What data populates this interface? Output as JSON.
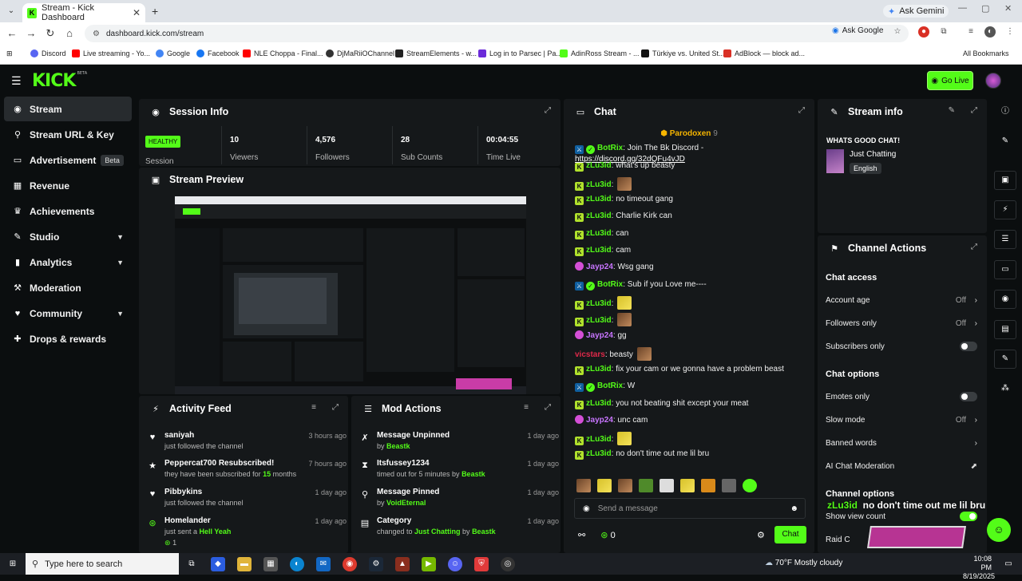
{
  "browser": {
    "tab_title": "Stream - Kick Dashboard",
    "url": "dashboard.kick.com/stream",
    "gemini_label": "Ask Gemini",
    "ask_google": "Ask Google",
    "bookmarks": [
      "Discord",
      "Live streaming - Yo...",
      "Google",
      "Facebook",
      "NLE Choppa - Final...",
      "DjMaRiiOChannel",
      "StreamElements - w...",
      "Log in to Parsec | Pa...",
      "AdinRoss Stream - ...",
      "Türkiye vs. United St...",
      "AdBlock — block ad..."
    ],
    "all_bookmarks": "All Bookmarks"
  },
  "topbar": {
    "logo": "KICK",
    "beta": "BETA",
    "go_live": "Go Live"
  },
  "sidebar": {
    "items": [
      {
        "label": "Stream",
        "icon": "broadcast-icon"
      },
      {
        "label": "Stream URL & Key",
        "icon": "key-icon"
      },
      {
        "label": "Advertisement",
        "icon": "ad-icon",
        "badge": "Beta"
      },
      {
        "label": "Revenue",
        "icon": "revenue-icon"
      },
      {
        "label": "Achievements",
        "icon": "trophy-icon"
      },
      {
        "label": "Studio",
        "icon": "studio-icon"
      },
      {
        "label": "Analytics",
        "icon": "analytics-icon"
      },
      {
        "label": "Moderation",
        "icon": "moderation-icon"
      },
      {
        "label": "Community",
        "icon": "community-icon"
      },
      {
        "label": "Drops & rewards",
        "icon": "gift-icon"
      }
    ]
  },
  "session": {
    "title": "Session Info",
    "health": "HEALTHY",
    "session_label": "Session",
    "viewers": "10",
    "viewers_label": "Viewers",
    "followers": "4,576",
    "followers_label": "Followers",
    "subs": "28",
    "subs_label": "Sub Counts",
    "time": "00:04:55",
    "time_label": "Time Live"
  },
  "preview": {
    "title": "Stream Preview"
  },
  "activity": {
    "title": "Activity Feed",
    "items": [
      {
        "name": "saniyah",
        "sub": "just followed the channel",
        "time": "3 hours ago"
      },
      {
        "name": "Peppercat700 Resubscribed!",
        "sub_pre": "they have been subscribed for ",
        "sub_num": "15",
        "sub_post": " months",
        "time": "7 hours ago"
      },
      {
        "name": "Pibbykins",
        "sub": "just followed the channel",
        "time": "1 day ago"
      },
      {
        "name": "Homelander",
        "sub_pre": "just sent a ",
        "sub_hl": "Hell Yeah",
        "count": "1",
        "time": "1 day ago"
      }
    ]
  },
  "mod": {
    "title": "Mod Actions",
    "items": [
      {
        "name": "Message Unpinned",
        "by": "by ",
        "who": "Beastk",
        "time": "1 day ago"
      },
      {
        "name": "Itsfussey1234",
        "pre": "timed out for 5 minutes by ",
        "who": "Beastk",
        "time": "1 day ago"
      },
      {
        "name": "Message Pinned",
        "by": "by ",
        "who": "VoidEternal",
        "time": "1 day ago"
      },
      {
        "name": "Category",
        "pre": "changed to ",
        "mid": "Just Chatting",
        "by": " by ",
        "who": "Beastk",
        "time": "1 day ago"
      }
    ]
  },
  "chat": {
    "title": "Chat",
    "pinned_user": "Parodoxen",
    "pinned_count": "9",
    "placeholder": "Send a message",
    "send": "Chat",
    "points": "0",
    "lines": [
      {
        "user": "BotRix",
        "cls": "un-g",
        "badges": [
          "mod",
          "ver"
        ],
        "text": ": Join The Bk Discord - ",
        "link": "https://discord.gg/32dQFu4vJD"
      },
      {
        "user": "zLu3id",
        "cls": "un-g",
        "badges": [
          "k"
        ],
        "text": ": what's up beasty"
      },
      {
        "user": "zLu3id",
        "cls": "un-g",
        "badges": [
          "k"
        ],
        "text": ": ",
        "emote": "brown"
      },
      {
        "user": "zLu3id",
        "cls": "un-g",
        "badges": [
          "k"
        ],
        "text": ": no timeout gang"
      },
      {
        "user": "zLu3id",
        "cls": "un-g",
        "badges": [
          "k"
        ],
        "text": ": Charlie Kirk can"
      },
      {
        "user": "zLu3id",
        "cls": "un-g",
        "badges": [
          "k"
        ],
        "text": ": can"
      },
      {
        "user": "zLu3id",
        "cls": "un-g",
        "badges": [
          "k"
        ],
        "text": ": cam"
      },
      {
        "user": "Jayp24",
        "cls": "un-v",
        "badges": [
          "sub"
        ],
        "text": ": Wsg gang"
      },
      {
        "user": "BotRix",
        "cls": "un-g",
        "badges": [
          "mod",
          "ver"
        ],
        "text": ": Sub if you Love me----"
      },
      {
        "user": "zLu3id",
        "cls": "un-g",
        "badges": [
          "k"
        ],
        "text": ": ",
        "emote": "y"
      },
      {
        "user": "zLu3id",
        "cls": "un-g",
        "badges": [
          "k"
        ],
        "text": ": ",
        "emote": "brown"
      },
      {
        "user": "Jayp24",
        "cls": "un-v",
        "badges": [
          "sub"
        ],
        "text": ": gg"
      },
      {
        "user": "vicstars",
        "cls": "un-r",
        "badges": [],
        "text": ": beasty ",
        "emote": "brown"
      },
      {
        "user": "zLu3id",
        "cls": "un-g",
        "badges": [
          "k"
        ],
        "text": ": fix your cam or we gonna have a problem beast"
      },
      {
        "user": "BotRix",
        "cls": "un-g",
        "badges": [
          "mod",
          "ver"
        ],
        "text": ": W"
      },
      {
        "user": "zLu3id",
        "cls": "un-g",
        "badges": [
          "k"
        ],
        "text": ": you not beating shit except your meat"
      },
      {
        "user": "Jayp24",
        "cls": "un-v",
        "badges": [
          "sub"
        ],
        "text": ": unc cam"
      },
      {
        "user": "zLu3id",
        "cls": "un-g",
        "badges": [
          "k"
        ],
        "text": ": ",
        "emote": "y"
      },
      {
        "user": "zLu3id",
        "cls": "un-g",
        "badges": [
          "k"
        ],
        "text": ": no don't time out me lil bru"
      }
    ]
  },
  "streaminfo": {
    "title": "Stream info",
    "stream_title": "WHATS GOOD CHAT!",
    "category": "Just Chatting",
    "language": "English"
  },
  "channel_actions": {
    "title": "Channel Actions",
    "chat_access": "Chat access",
    "account_age": "Account age",
    "account_age_val": "Off",
    "followers_only": "Followers only",
    "followers_only_val": "Off",
    "subscribers_only": "Subscribers only",
    "chat_options": "Chat options",
    "emotes_only": "Emotes only",
    "slow_mode": "Slow mode",
    "slow_mode_val": "Off",
    "banned_words": "Banned words",
    "ai_mod": "AI Chat Moderation",
    "channel_options": "Channel options",
    "show_view_count": "Show view count",
    "raid": "Raid C"
  },
  "overlay": {
    "user": "zLu3id",
    "text": "no don't time out me lil bru"
  },
  "taskbar": {
    "search": "Type here to search",
    "weather": "70°F  Mostly cloudy",
    "time": "10:08 PM",
    "date": "8/19/2025"
  }
}
